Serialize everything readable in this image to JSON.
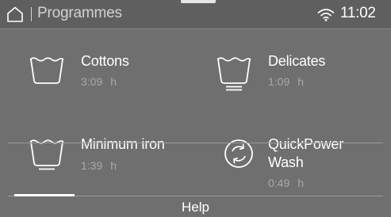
{
  "header": {
    "title": "Programmes",
    "time": "11:02",
    "home_icon": "home-icon",
    "wifi_icon": "wifi-icon"
  },
  "programmes": [
    {
      "name": "Cottons",
      "duration": "3:09",
      "unit": "h",
      "icon": "cottons-tub-icon"
    },
    {
      "name": "Delicates",
      "duration": "1:09",
      "unit": "h",
      "icon": "delicates-tub-icon"
    },
    {
      "name": "Minimum iron",
      "duration": "1:39",
      "unit": "h",
      "icon": "minimum-iron-tub-icon"
    },
    {
      "name": "QuickPower",
      "name_line2": "Wash",
      "duration": "0:49",
      "unit": "h",
      "icon": "quickpower-cycle-icon"
    }
  ],
  "footer": {
    "help_label": "Help"
  },
  "colors": {
    "background": "#6f6f6f",
    "header_background": "#5f5f5f",
    "secondary_text": "#a9a9a9"
  }
}
